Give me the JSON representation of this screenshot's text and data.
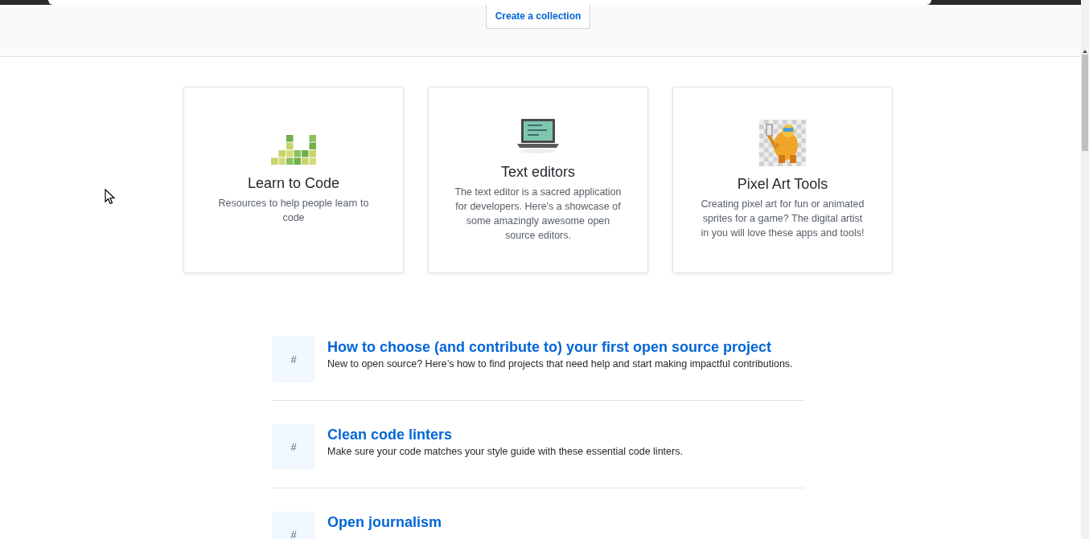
{
  "header": {
    "button": "Create a collection"
  },
  "cards": [
    {
      "kind": "blocks",
      "title": "Learn to Code",
      "description": "Resources to help people learn to code"
    },
    {
      "kind": "laptop",
      "title": "Text editors",
      "description": "The text editor is a sacred application for developers. Here's a showcase of some amazingly awesome open source editors."
    },
    {
      "kind": "sprite",
      "title": "Pixel Art Tools",
      "description": "Creating pixel art for fun or animated sprites for a game? The digital artist in you will love these apps and tools!"
    }
  ],
  "topics": [
    {
      "icon": "#",
      "title": "How to choose (and contribute to) your first open source project",
      "description": "New to open source? Here’s how to find projects that need help and start making impactful contributions."
    },
    {
      "icon": "#",
      "title": "Clean code linters",
      "description": "Make sure your code matches your style guide with these essential code linters."
    },
    {
      "icon": "#",
      "title": "Open journalism"
    }
  ]
}
